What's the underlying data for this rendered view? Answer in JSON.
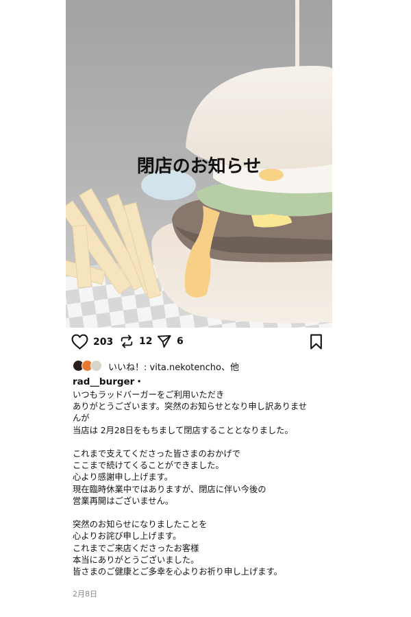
{
  "post": {
    "image_title": "閉店のお知らせ",
    "likes_count": "203",
    "reposts_count": "12",
    "shares_count": "6",
    "liked_by_text": "いいね！: vita.nekotencho、他",
    "username": "rad__burger・",
    "caption_lines": [
      "いつもラッドバーガーをご利用いただき",
      "ありがとうございます。突然のお知らせとなり申し訳ありませ",
      "んが",
      "当店は 2月28日をもちまして閉店することとなりました。",
      "",
      "これまで支えてくださった皆さまのおかげで",
      "ここまで続けてくることができました。",
      "心より感謝申し上げます。",
      "現在臨時休業中ではありますが、閉店に伴い今後の",
      "営業再開はございません。",
      "",
      "突然のお知らせになりましたことを",
      "心よりお詫び申し上げます。",
      "これまでご来店くださったお客様",
      "本当にありがとうございました。",
      "皆さまのご健康とご多幸を心よりお祈り申し上げます。"
    ],
    "date": "2月8日"
  },
  "icons": {
    "like": "heart-icon",
    "repost": "repost-icon",
    "share": "send-icon",
    "save": "bookmark-icon"
  },
  "colors": {
    "text": "#111111",
    "muted": "#888888"
  }
}
